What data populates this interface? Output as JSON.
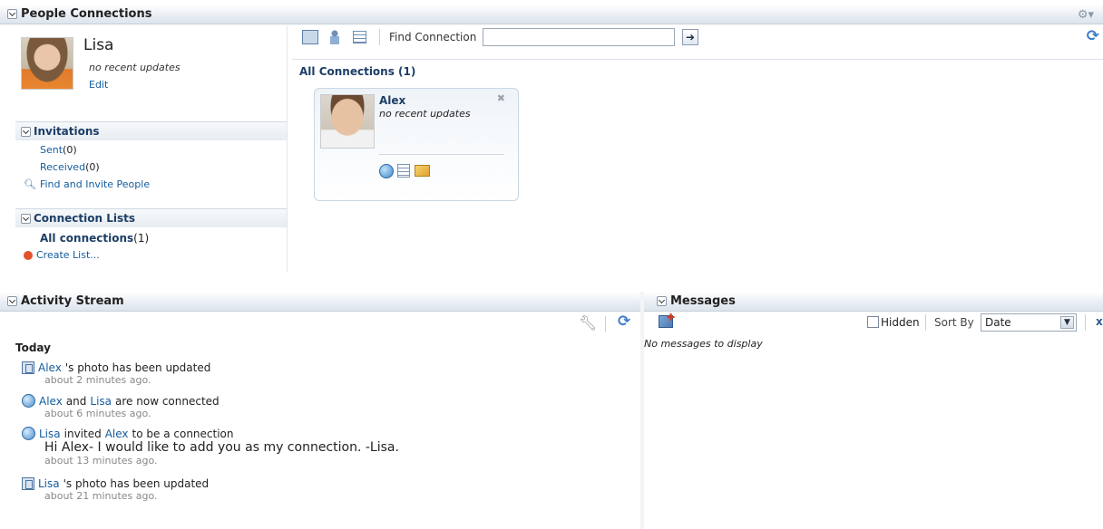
{
  "people": {
    "header": "People Connections",
    "profile": {
      "name": "Lisa",
      "status": "no recent updates",
      "edit": "Edit"
    },
    "invitations": {
      "title": "Invitations",
      "sent_label": "Sent",
      "sent_count": "(0)",
      "received_label": "Received",
      "received_count": "(0)",
      "find": "Find and Invite People"
    },
    "connection_lists": {
      "title": "Connection Lists",
      "all_label": "All connections",
      "all_count": "(1)",
      "create": "Create List..."
    },
    "toolbar": {
      "find_label": "Find Connection",
      "find_value": ""
    },
    "all_connections": "All Connections (1)",
    "card": {
      "name": "Alex",
      "status": "no recent updates"
    }
  },
  "activity": {
    "header": "Activity Stream",
    "day": "Today",
    "items": [
      {
        "a": "Alex",
        "text": "'s photo has been updated",
        "time": "about 2 minutes ago."
      },
      {
        "a": "Alex",
        "mid": "and",
        "b": "Lisa",
        "text": "are now connected",
        "time": "about 6 minutes ago."
      },
      {
        "a": "Lisa",
        "mid": "invited",
        "b": "Alex",
        "text": "to be a connection",
        "message": "Hi Alex- I would like to add you as my connection. -Lisa.",
        "time": "about 13 minutes ago."
      },
      {
        "a": "Lisa",
        "text": "'s photo has been updated",
        "time": "about 21 minutes ago."
      }
    ]
  },
  "messages": {
    "header": "Messages",
    "empty": "No messages to display",
    "hidden_label": "Hidden",
    "sort_label": "Sort By",
    "sort_value": "Date"
  }
}
